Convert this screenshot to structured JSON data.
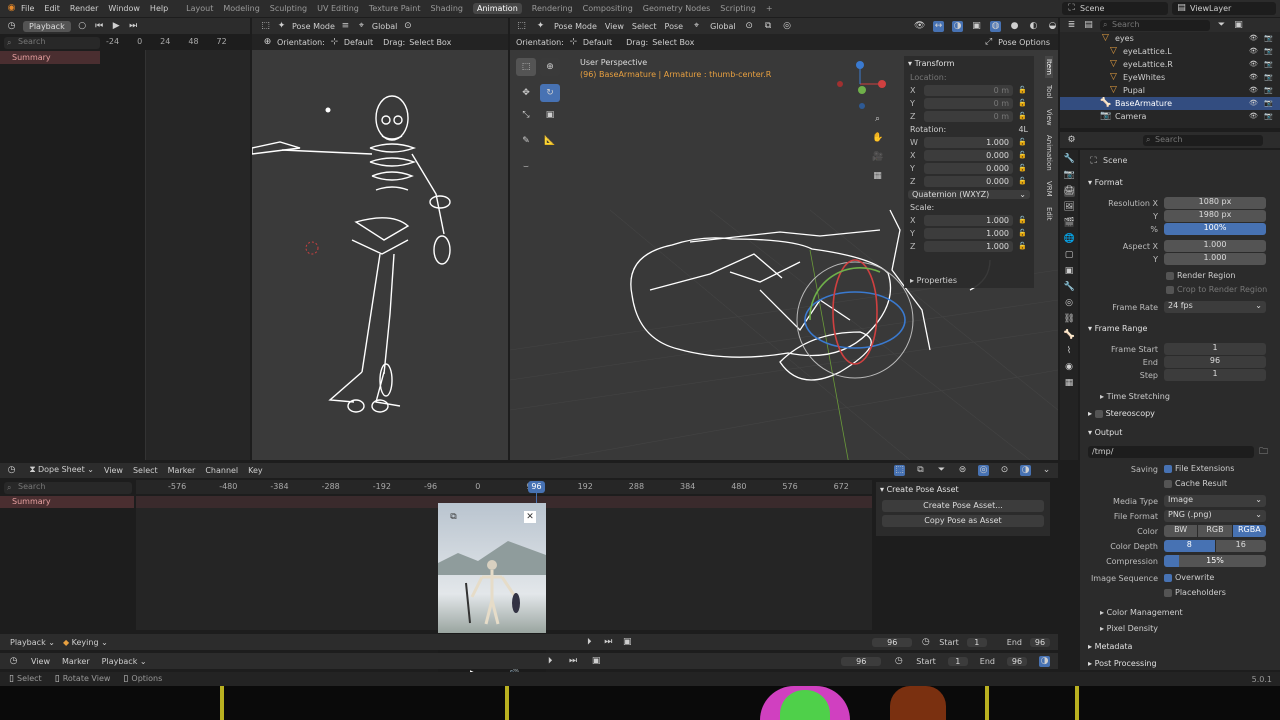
{
  "topbar": {
    "menus": [
      "File",
      "Edit",
      "Render",
      "Window",
      "Help"
    ],
    "workspaces": [
      "Layout",
      "Modeling",
      "Sculpting",
      "UV Editing",
      "Texture Paint",
      "Shading",
      "Animation",
      "Rendering",
      "Compositing",
      "Geometry Nodes",
      "Scripting"
    ],
    "active_workspace": "Animation",
    "scene": "Scene",
    "view_layer": "ViewLayer"
  },
  "left_timeline": {
    "mode": "Playback",
    "ticks": [
      "-24",
      "0",
      "24",
      "48",
      "72"
    ],
    "search_placeholder": "Search",
    "summary": "Summary"
  },
  "camera_view": {
    "mode": "Pose Mode",
    "transform": "Global",
    "orientation_label": "Orientation:",
    "orientation": "Default",
    "drag_label": "Drag:",
    "drag": "Select Box"
  },
  "viewport": {
    "mode": "Pose Mode",
    "menus": [
      "View",
      "Select",
      "Pose"
    ],
    "transform": "Global",
    "orientation_label": "Orientation:",
    "orientation": "Default",
    "drag_label": "Drag:",
    "drag": "Select Box",
    "pose_options": "Pose Options",
    "overlay_title": "User Perspective",
    "overlay_subtitle": "(96) BaseArmature | Armature : thumb-center.R"
  },
  "transform_panel": {
    "title": "Transform",
    "location_label": "Location:",
    "location": [
      {
        "axis": "X",
        "value": "0 m"
      },
      {
        "axis": "Y",
        "value": "0 m"
      },
      {
        "axis": "Z",
        "value": "0 m"
      }
    ],
    "rotation_label": "Rotation:",
    "rotation_mode_short": "4L",
    "rotation": [
      {
        "axis": "W",
        "value": "1.000"
      },
      {
        "axis": "X",
        "value": "0.000"
      },
      {
        "axis": "Y",
        "value": "0.000"
      },
      {
        "axis": "Z",
        "value": "0.000"
      }
    ],
    "rotation_mode": "Quaternion (WXYZ)",
    "scale_label": "Scale:",
    "scale": [
      {
        "axis": "X",
        "value": "1.000"
      },
      {
        "axis": "Y",
        "value": "1.000"
      },
      {
        "axis": "Z",
        "value": "1.000"
      }
    ],
    "properties_label": "Properties",
    "side_tabs": [
      "Item",
      "Tool",
      "View",
      "Animation",
      "VRM",
      "Edit"
    ]
  },
  "outliner": {
    "search_placeholder": "Search",
    "items": [
      {
        "name": "eyes",
        "selected": false
      },
      {
        "name": "eyeLattice.L",
        "selected": false
      },
      {
        "name": "eyeLattice.R",
        "selected": false
      },
      {
        "name": "EyeWhites",
        "selected": false
      },
      {
        "name": "Pupal",
        "selected": false
      },
      {
        "name": "BaseArmature",
        "selected": true
      },
      {
        "name": "Camera",
        "selected": false
      }
    ]
  },
  "properties": {
    "search_placeholder": "Search",
    "context": "Scene",
    "format_header": "Format",
    "resolution_x_label": "Resolution X",
    "resolution_x": "1080 px",
    "resolution_y_label": "Y",
    "resolution_y": "1980 px",
    "percent_label": "%",
    "percent": "100%",
    "aspect_x_label": "Aspect X",
    "aspect_x": "1.000",
    "aspect_y_label": "Y",
    "aspect_y": "1.000",
    "render_region": "Render Region",
    "crop_region": "Crop to Render Region",
    "frame_rate_label": "Frame Rate",
    "frame_rate": "24 fps",
    "frame_range_header": "Frame Range",
    "frame_start_label": "Frame Start",
    "frame_start": "1",
    "end_label": "End",
    "end": "96",
    "step_label": "Step",
    "step": "1",
    "time_stretching": "Time Stretching",
    "stereoscopy": "Stereoscopy",
    "output_header": "Output",
    "output_path": "/tmp/",
    "saving_label": "Saving",
    "file_extensions": "File Extensions",
    "cache_result": "Cache Result",
    "media_type_label": "Media Type",
    "media_type": "Image",
    "file_format_label": "File Format",
    "file_format": "PNG (.png)",
    "color_label": "Color",
    "color_options": [
      "BW",
      "RGB",
      "RGBA"
    ],
    "color_depth_label": "Color Depth",
    "color_depth_options": [
      "8",
      "16"
    ],
    "compression_label": "Compression",
    "compression": "15%",
    "compression_fraction": 0.15,
    "image_sequence_label": "Image Sequence",
    "overwrite": "Overwrite",
    "placeholders": "Placeholders",
    "color_management": "Color Management",
    "pixel_density": "Pixel Density",
    "metadata": "Metadata",
    "post_processing": "Post Processing"
  },
  "dopesheet": {
    "mode": "Dope Sheet",
    "menus": [
      "View",
      "Select",
      "Marker",
      "Channel",
      "Key"
    ],
    "search_placeholder": "Search",
    "ticks": [
      "-576",
      "-480",
      "-384",
      "-288",
      "-192",
      "-96",
      "0",
      "96",
      "192",
      "288",
      "384",
      "480",
      "576",
      "672"
    ],
    "current_frame": "96",
    "summary": "Summary",
    "create_pose_asset_header": "Create Pose Asset",
    "create_pose_asset_button": "Create Pose Asset...",
    "copy_pose_asset_button": "Copy Pose as Asset"
  },
  "playback_bar": {
    "playback": "Playback",
    "keying": "Keying",
    "frame": "96",
    "start_label": "Start",
    "start": "1",
    "end_label": "End",
    "end": "96"
  },
  "timeline_bar": {
    "menus": [
      "View",
      "Marker",
      "Playback"
    ],
    "frame": "96",
    "start_label": "Start",
    "start": "1",
    "end_label": "End",
    "end": "96"
  },
  "statusbar": {
    "select": "Select",
    "rotate_view": "Rotate View",
    "options": "Options",
    "version": "5.0.1"
  },
  "colors": {
    "accent_blue": "#4772b3",
    "active_tab_orange": "#e0903a",
    "selected_row": "#334d80"
  }
}
